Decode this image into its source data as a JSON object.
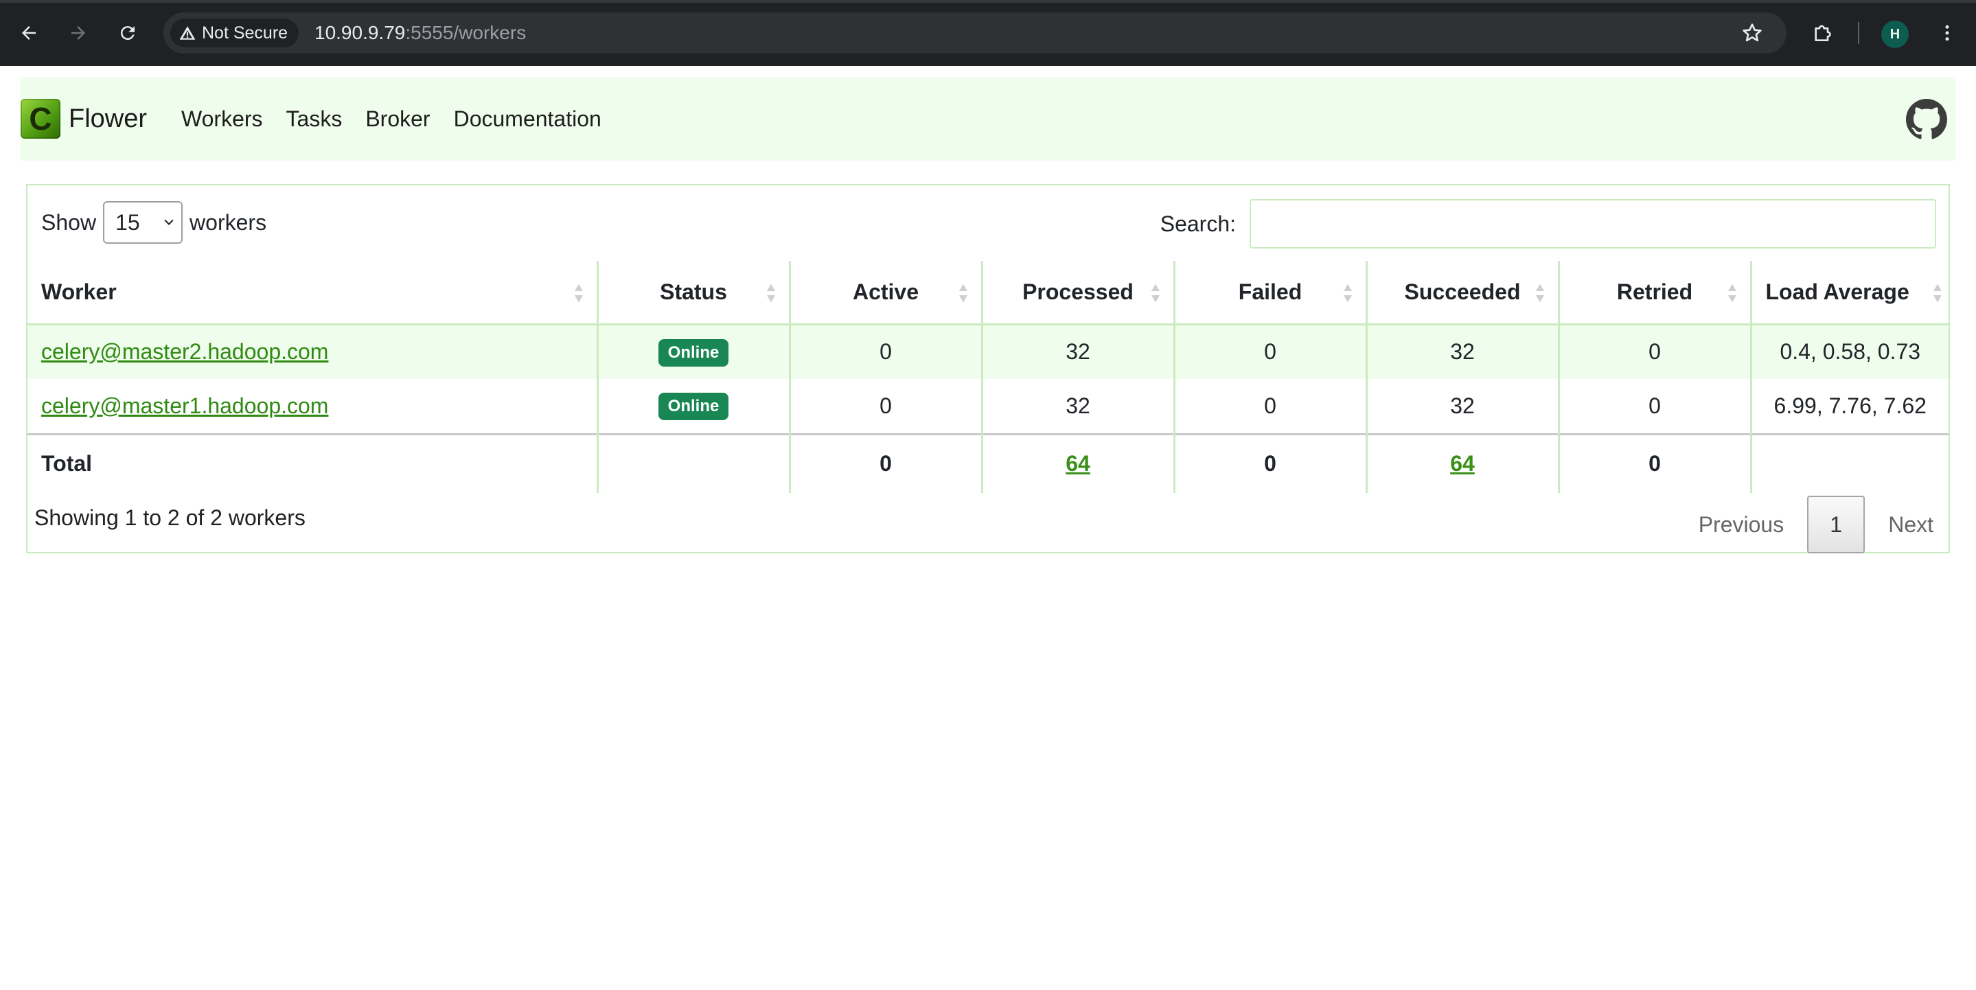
{
  "browser": {
    "security_label": "Not Secure",
    "url_host": "10.90.9.79",
    "url_rest": ":5555/workers",
    "profile_initial": "H"
  },
  "navbar": {
    "brand_logo_letter": "C",
    "brand_name": "Flower",
    "links": [
      "Workers",
      "Tasks",
      "Broker",
      "Documentation"
    ]
  },
  "controls": {
    "show_label": "Show",
    "page_size": "15",
    "page_size_suffix": "workers",
    "search_label": "Search:",
    "search_value": ""
  },
  "table": {
    "columns": [
      "Worker",
      "Status",
      "Active",
      "Processed",
      "Failed",
      "Succeeded",
      "Retried",
      "Load Average"
    ],
    "rows": [
      {
        "worker": "celery@master2.hadoop.com",
        "status": "Online",
        "active": "0",
        "processed": "32",
        "failed": "0",
        "succeeded": "32",
        "retried": "0",
        "load": "0.4, 0.58, 0.73"
      },
      {
        "worker": "celery@master1.hadoop.com",
        "status": "Online",
        "active": "0",
        "processed": "32",
        "failed": "0",
        "succeeded": "32",
        "retried": "0",
        "load": "6.99, 7.76, 7.62"
      }
    ],
    "total": {
      "label": "Total",
      "active": "0",
      "processed": "64",
      "failed": "0",
      "succeeded": "64",
      "retried": "0",
      "load": ""
    }
  },
  "footer": {
    "info": "Showing 1 to 2 of 2 workers",
    "previous": "Previous",
    "current_page": "1",
    "next": "Next"
  },
  "colors": {
    "navbar_bg": "#effdec",
    "border": "#c9ebc0",
    "link": "#2f8a12",
    "badge": "#198754"
  }
}
